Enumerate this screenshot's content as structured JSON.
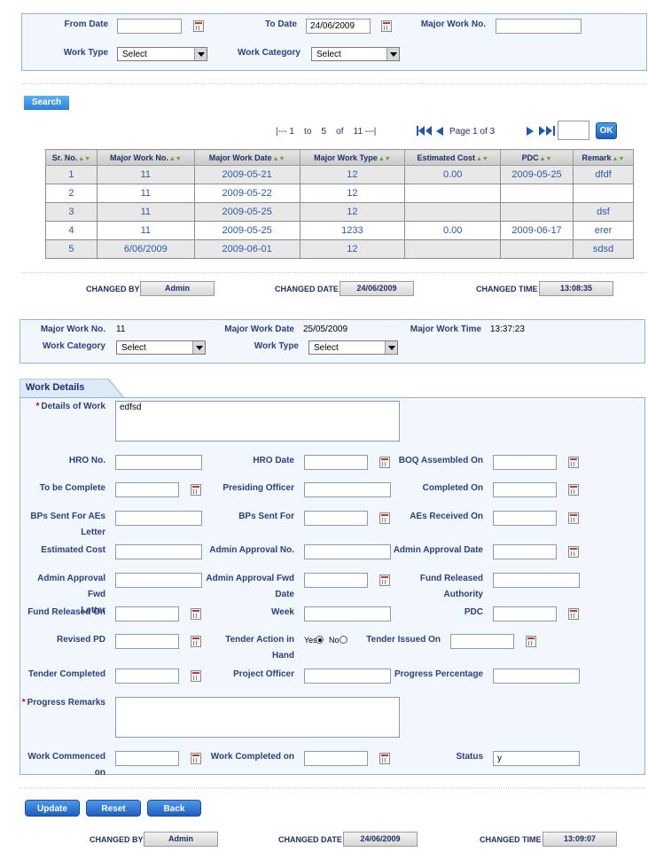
{
  "filters": {
    "from_date_label": "From Date",
    "from_date_value": "",
    "to_date_label": "To Date",
    "to_date_value": "24/06/2009",
    "major_work_no_label": "Major Work No.",
    "major_work_no_value": "",
    "work_type_label": "Work Type",
    "work_type_value": "Select",
    "work_category_label": "Work Category",
    "work_category_value": "Select",
    "search_label": "Search"
  },
  "pager": {
    "range_text": "|--- 1    to    5    of    11 ---|",
    "page_text": "Page 1 of 3",
    "page_input": "",
    "ok_label": "OK"
  },
  "table": {
    "headers": [
      "Sr. No.",
      "Major Work No.",
      "Major Work Date",
      "Major Work Type",
      "Estimated Cost",
      "PDC",
      "Remark"
    ],
    "rows": [
      [
        "1",
        "11",
        "2009-05-21",
        "12",
        "0.00",
        "2009-05-25",
        "dfdf"
      ],
      [
        "2",
        "11",
        "2009-05-22",
        "12",
        "",
        "",
        ""
      ],
      [
        "3",
        "11",
        "2009-05-25",
        "12",
        "",
        "",
        "dsf"
      ],
      [
        "4",
        "11",
        "2009-05-25",
        "1233",
        "0.00",
        "2009-06-17",
        "erer"
      ],
      [
        "5",
        "6/06/2009",
        "2009-06-01",
        "12",
        "",
        "",
        "sdsd"
      ]
    ]
  },
  "meta1": {
    "changed_by_label": "CHANGED BY",
    "changed_by": "Admin",
    "changed_date_label": "CHANGED DATE",
    "changed_date": "24/06/2009",
    "changed_time_label": "CHANGED TIME",
    "changed_time": "13:08:35"
  },
  "summary": {
    "major_work_no_label": "Major Work No.",
    "major_work_no": "11",
    "major_work_date_label": "Major Work Date",
    "major_work_date": "25/05/2009",
    "major_work_time_label": "Major Work Time",
    "major_work_time": "13:37:23",
    "work_category_label": "Work Category",
    "work_category_value": "Select",
    "work_type_label": "Work Type",
    "work_type_value": "Select"
  },
  "details": {
    "tab_label": "Work Details",
    "details_of_work_label": "Details of Work",
    "details_of_work_value": "edfsd",
    "hro_no_label": "HRO No.",
    "hro_date_label": "HRO Date",
    "boq_label": "BOQ Assembled On",
    "to_be_complete_label": "To be Complete",
    "presiding_officer_label": "Presiding Officer",
    "completed_on_label": "Completed On",
    "bps_sent_aes_label_1": "BPs Sent For AEs",
    "bps_sent_aes_label_2": "Letter",
    "bps_sent_for_label": "BPs Sent For",
    "aes_received_label": "AEs Received On",
    "estimated_cost_label": "Estimated Cost",
    "admin_approval_no_label": "Admin Approval No.",
    "admin_approval_date_label": "Admin Approval Date",
    "admin_fwd_letter_label_1": "Admin Approval Fwd",
    "admin_fwd_letter_label_2": "Letter",
    "admin_fwd_date_label_1": "Admin Approval Fwd",
    "admin_fwd_date_label_2": "Date",
    "fund_released_auth_label_1": "Fund Released",
    "fund_released_auth_label_2": "Authority",
    "fund_released_on_label": "Fund Released On",
    "week_label": "Week",
    "pdc_label": "PDC",
    "revised_pd_label": "Revised PD",
    "tender_action_label_1": "Tender Action in",
    "tender_action_label_2": "Hand",
    "yes_label": "Yes",
    "no_label": "No",
    "tender_issued_label": "Tender Issued On",
    "tender_completed_label": "Tender Completed",
    "project_officer_label": "Project Officer",
    "progress_pct_label": "Progress Percentage",
    "progress_remarks_label": "Progress Remarks",
    "work_commenced_label": "Work Commenced on",
    "work_completed_label": "Work Completed on",
    "status_label": "Status",
    "status_value": "y"
  },
  "actions": {
    "update_label": "Update",
    "reset_label": "Reset",
    "back_label": "Back"
  },
  "meta2": {
    "changed_by_label": "CHANGED BY",
    "changed_by": "Admin",
    "changed_date_label": "CHANGED DATE",
    "changed_date": "24/06/2009",
    "changed_time_label": "CHANGED TIME",
    "changed_time": "13:09:07"
  }
}
